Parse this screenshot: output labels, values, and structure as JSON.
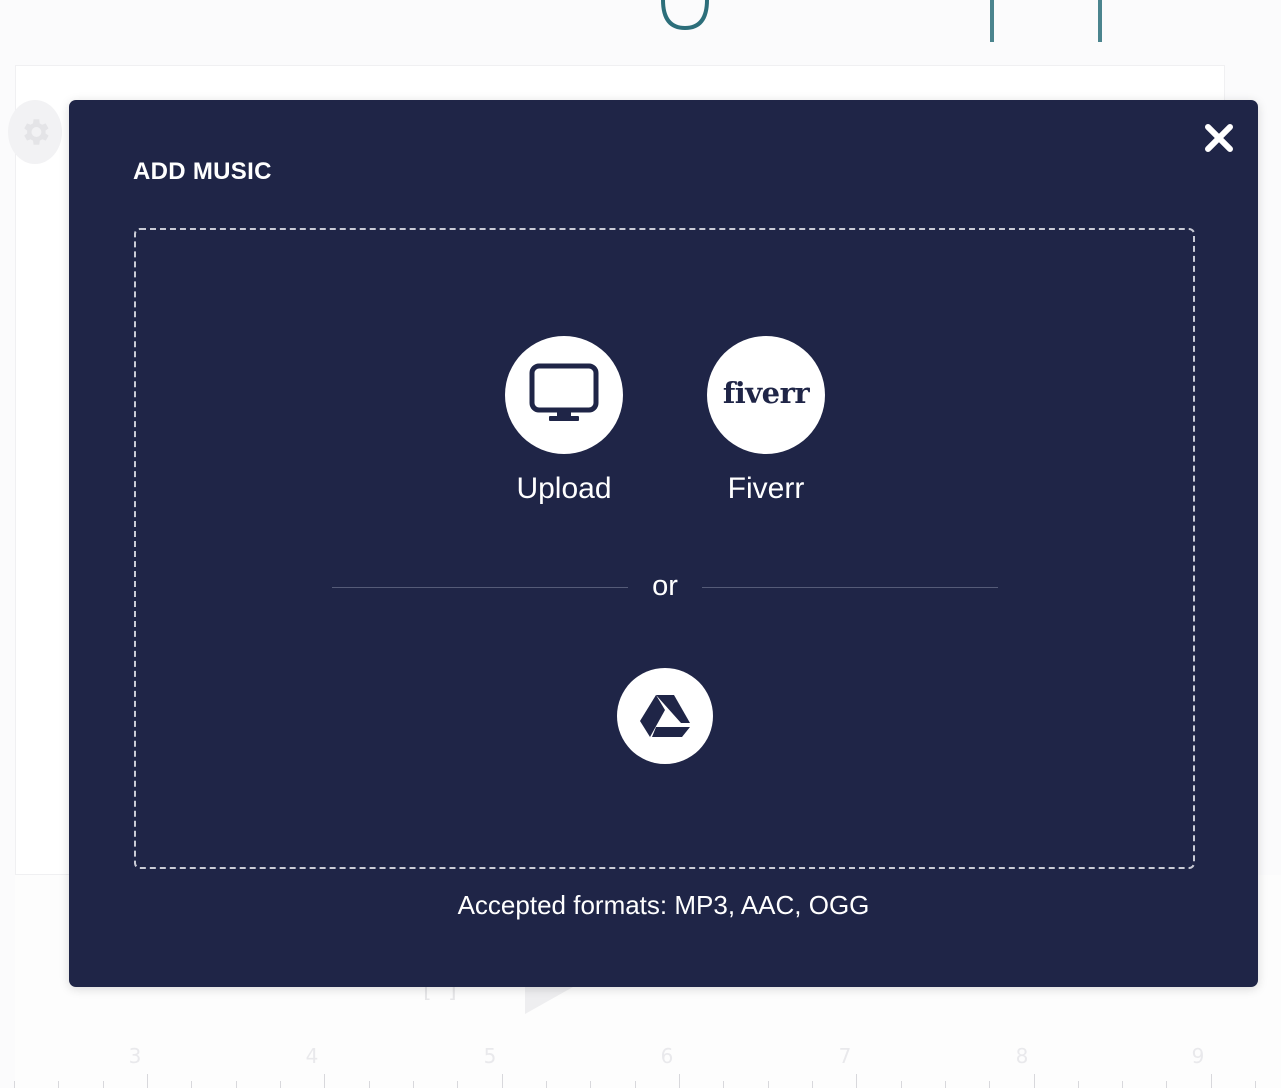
{
  "background": {
    "ruler_labels": [
      "3",
      "4",
      "5",
      "6",
      "7",
      "8",
      "9"
    ]
  },
  "modal": {
    "title": "ADD MUSIC",
    "close_icon": "close-icon",
    "sources": [
      {
        "label": "Upload",
        "icon": "monitor-icon"
      },
      {
        "label": "Fiverr",
        "icon": "fiverr-logo",
        "logo_text": "fiverr"
      }
    ],
    "divider_text": "or",
    "drive_icon": "google-drive-icon",
    "accepted_formats": "Accepted formats: MP3, AAC, OGG"
  },
  "colors": {
    "modal_bg": "#1f2547",
    "text": "#ffffff",
    "accent_teal": "#2c6e7a"
  }
}
